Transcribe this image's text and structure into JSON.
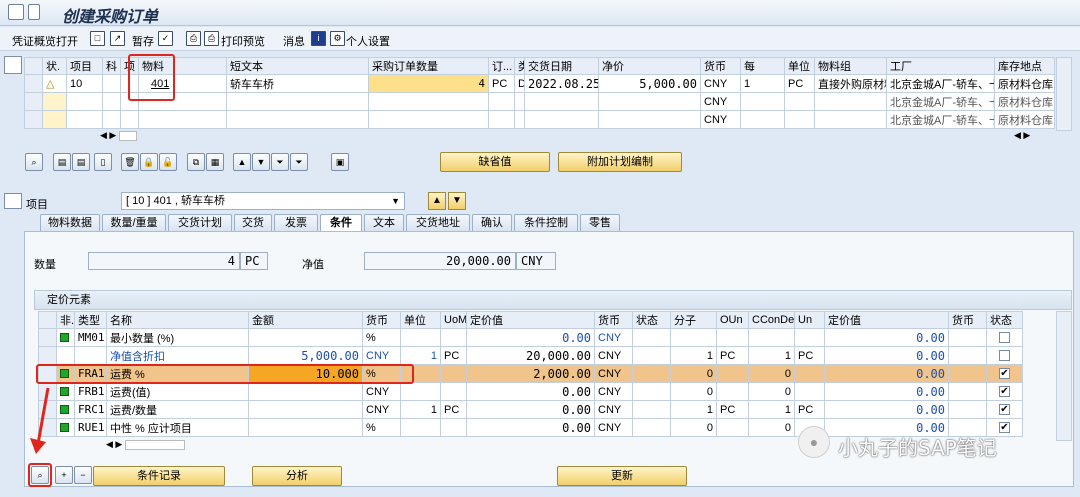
{
  "window": {
    "title": "创建采购订单"
  },
  "toolbar": {
    "doc_overview": "凭证概览打开",
    "hold": "暂存",
    "print_preview": "打印预览",
    "messages": "消息",
    "personal_settings": "个人设置"
  },
  "item_table": {
    "headers": [
      "状.",
      "项目",
      "科",
      "项",
      "物料",
      "短文本",
      "采购订单数量",
      "订...",
      "类",
      "交货日期",
      "净价",
      "货币",
      "每",
      "单位",
      "物料组",
      "工厂",
      "库存地点"
    ],
    "rows": [
      {
        "status": "△",
        "item": "10",
        "material": "401",
        "short_text": "轿车车桥",
        "qty": "4",
        "unit": "PC",
        "cat": "D",
        "delivery_date": "2022.08.25",
        "net_price": "5,000.00",
        "currency": "CNY",
        "per": "1",
        "order_unit": "PC",
        "mat_group": "直接外购原材料",
        "plant": "北京金城A厂-轿车、卡",
        "storage": "原材料仓库"
      },
      {
        "currency": "CNY",
        "plant": "北京金城A厂-轿车、卡",
        "storage": "原材料仓库"
      },
      {
        "currency": "CNY",
        "plant": "北京金城A厂-轿车、卡",
        "storage": "原材料仓库"
      }
    ]
  },
  "buttons": {
    "default_values": "缺省值",
    "addl_planning": "附加计划编制",
    "condition_record": "条件记录",
    "analysis": "分析",
    "update": "更新"
  },
  "item_detail": {
    "label": "项目",
    "selected": "[ 10 ] 401 , 轿车车桥"
  },
  "tabs": [
    "物料数据",
    "数量/重量",
    "交货计划",
    "交货",
    "发票",
    "条件",
    "文本",
    "交货地址",
    "确认",
    "条件控制",
    "零售"
  ],
  "conditions": {
    "qty_label": "数量",
    "qty_value": "4",
    "qty_unit": "PC",
    "net_label": "净值",
    "net_value": "20,000.00",
    "net_currency": "CNY",
    "pricing_title": "定价元素",
    "headers": [
      "非.",
      "类型",
      "名称",
      "金额",
      "货币",
      "单位",
      "UoM",
      "定价值",
      "货币",
      "状态",
      "分子",
      "OUn",
      "CConDe",
      "Un",
      "定价值",
      "货币",
      "状态"
    ],
    "rows": [
      {
        "type": "MM01",
        "name": "最小数量 (%)",
        "amount": "",
        "curr": "%",
        "unit": "",
        "uom": "",
        "value": "0.00",
        "vcurr": "CNY",
        "num": "",
        "oun": "",
        "ccon": "",
        "un": "",
        "cvalue": "0.00",
        "checked": false,
        "bar": true
      },
      {
        "type": "",
        "name": "净值含折扣",
        "amount": "5,000.00",
        "curr": "CNY",
        "unit": "1",
        "uom": "PC",
        "value": "20,000.00",
        "vcurr": "CNY",
        "num": "1",
        "oun": "PC",
        "ccon": "1",
        "un": "PC",
        "cvalue": "0.00",
        "checked": false,
        "bar": false
      },
      {
        "type": "FRA1",
        "name": "运费 %",
        "amount": "10.000",
        "curr": "%",
        "unit": "",
        "uom": "",
        "value": "2,000.00",
        "vcurr": "CNY",
        "num": "0",
        "oun": "",
        "ccon": "0",
        "un": "",
        "cvalue": "0.00",
        "checked": true,
        "bar": true
      },
      {
        "type": "FRB1",
        "name": "运费(值)",
        "amount": "",
        "curr": "CNY",
        "unit": "",
        "uom": "",
        "value": "0.00",
        "vcurr": "CNY",
        "num": "0",
        "oun": "",
        "ccon": "0",
        "un": "",
        "cvalue": "0.00",
        "checked": true,
        "bar": true
      },
      {
        "type": "FRC1",
        "name": "运费/数量",
        "amount": "",
        "curr": "CNY",
        "unit": "1",
        "uom": "PC",
        "value": "0.00",
        "vcurr": "CNY",
        "num": "1",
        "oun": "PC",
        "ccon": "1",
        "un": "PC",
        "cvalue": "0.00",
        "checked": true,
        "bar": true
      },
      {
        "type": "RUE1",
        "name": "中性 % 应计项目",
        "amount": "",
        "curr": "%",
        "unit": "",
        "uom": "",
        "value": "0.00",
        "vcurr": "CNY",
        "num": "0",
        "oun": "",
        "ccon": "0",
        "un": "",
        "cvalue": "0.00",
        "checked": true,
        "bar": true
      }
    ]
  },
  "watermark": "小丸子的SAP笔记"
}
